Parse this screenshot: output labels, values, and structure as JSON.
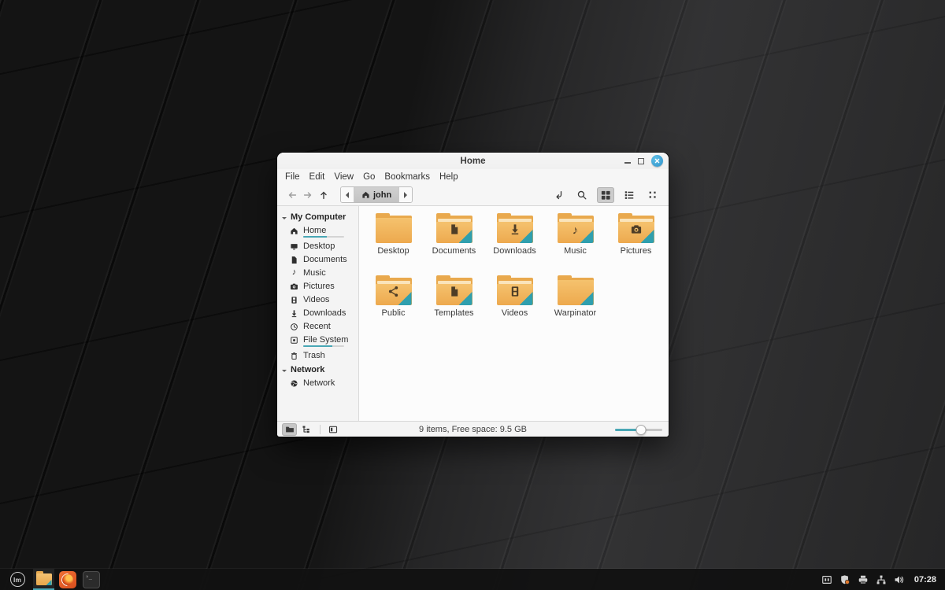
{
  "colors": {
    "accent": "#49a7b5",
    "close_button": "#3d9fd2",
    "folder": "#f0b35e",
    "panel": "#121212",
    "emblem": "#4e3d26"
  },
  "taskbar": {
    "menu_label": "lm",
    "apps": [
      {
        "name": "files"
      },
      {
        "name": "firefox"
      },
      {
        "name": "terminal",
        "glyph": "›_"
      }
    ],
    "clock": "07:28"
  },
  "window": {
    "title": "Home",
    "menubar": {
      "items": [
        "File",
        "Edit",
        "View",
        "Go",
        "Bookmarks",
        "Help"
      ]
    },
    "toolbar": {
      "breadcrumb_current": "john"
    },
    "sidebar": {
      "sections": [
        {
          "header": "My Computer",
          "items": [
            {
              "label": "Home",
              "icon": "home",
              "usage": "57%"
            },
            {
              "label": "Desktop",
              "icon": "desktop"
            },
            {
              "label": "Documents",
              "icon": "document"
            },
            {
              "label": "Music",
              "icon": "music-note"
            },
            {
              "label": "Pictures",
              "icon": "camera"
            },
            {
              "label": "Videos",
              "icon": "film"
            },
            {
              "label": "Downloads",
              "icon": "download-arrow"
            },
            {
              "label": "Recent",
              "icon": "clock"
            },
            {
              "label": "File System",
              "icon": "disk",
              "usage": "72%"
            },
            {
              "label": "Trash",
              "icon": "trash"
            }
          ]
        },
        {
          "header": "Network",
          "items": [
            {
              "label": "Network",
              "icon": "globe"
            }
          ]
        }
      ]
    },
    "files": [
      {
        "label": "Desktop",
        "emblem": "none",
        "teal": false
      },
      {
        "label": "Documents",
        "emblem": "document",
        "teal": true
      },
      {
        "label": "Downloads",
        "emblem": "download",
        "teal": true
      },
      {
        "label": "Music",
        "emblem": "note",
        "teal": true
      },
      {
        "label": "Pictures",
        "emblem": "camera",
        "teal": true
      },
      {
        "label": "Public",
        "emblem": "share",
        "teal": true
      },
      {
        "label": "Templates",
        "emblem": "document",
        "teal": true
      },
      {
        "label": "Videos",
        "emblem": "film",
        "teal": true
      },
      {
        "label": "Warpinator",
        "emblem": "none",
        "teal": true
      }
    ],
    "statusbar": {
      "text": "9 items, Free space: 9.5 GB",
      "zoom_fill": "55%",
      "zoom_handle": "55%"
    }
  }
}
